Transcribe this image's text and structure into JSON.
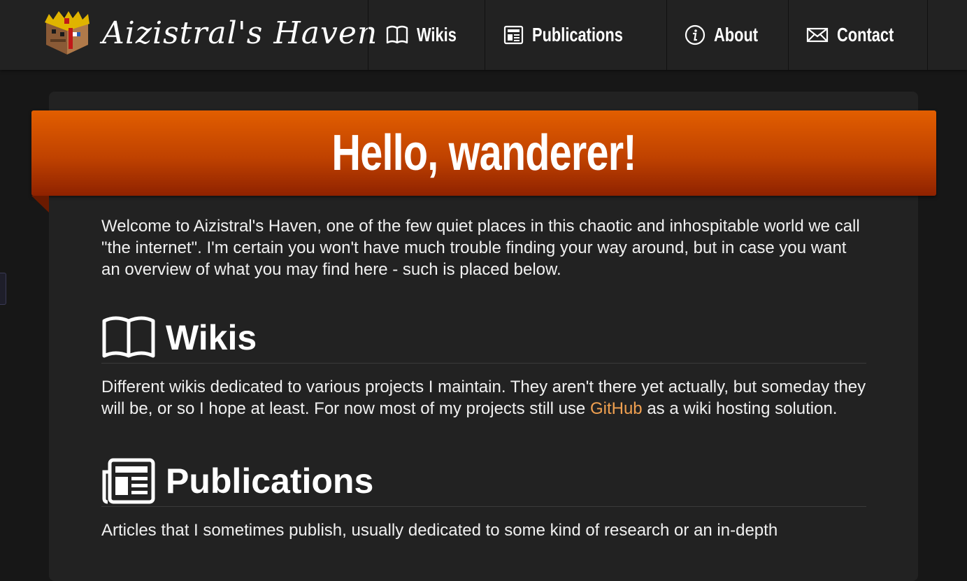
{
  "brand": {
    "name": "Aizistral's Haven"
  },
  "nav": [
    {
      "label": "Wikis",
      "icon": "book-icon"
    },
    {
      "label": "Publications",
      "icon": "newspaper-icon"
    },
    {
      "label": "About",
      "icon": "info-icon"
    },
    {
      "label": "Contact",
      "icon": "envelope-icon"
    }
  ],
  "hero": {
    "title": "Hello, wanderer!"
  },
  "intro": "Welcome to Aizistral's Haven, one of the few quiet places in this chaotic and inhospitable world we call \"the internet\". I'm certain you won't have much trouble finding your way around, but in case you want an overview of what you may find here - such is placed below.",
  "sections": {
    "wikis": {
      "title": "Wikis",
      "text_before": "Different wikis dedicated to various projects I maintain. They aren't there yet actually, but someday they will be, or so I hope at least. For now most of my projects still use ",
      "link": "GitHub",
      "text_after": " as a wiki hosting solution."
    },
    "publications": {
      "title": "Publications",
      "text": "Articles that I sometimes publish, usually dedicated to some kind of research or an in-depth"
    }
  },
  "colors": {
    "accent": "#e25e00",
    "link": "#f0a050",
    "background": "#171717",
    "panel": "#222222"
  }
}
